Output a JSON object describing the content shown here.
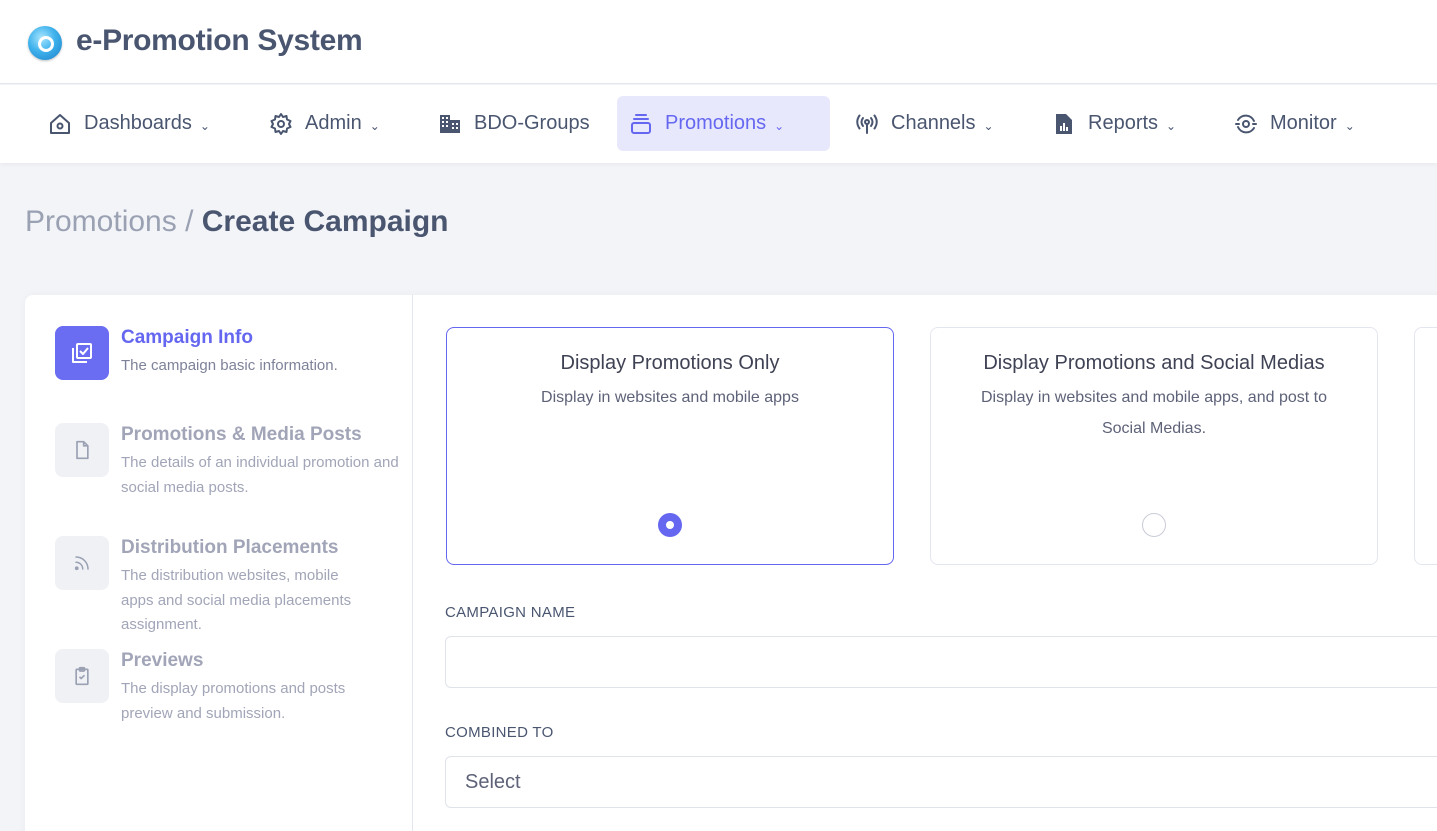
{
  "app": {
    "title": "e-Promotion System"
  },
  "nav": {
    "items": [
      {
        "label": "Dashboards",
        "icon": "home-icon",
        "dropdown": true
      },
      {
        "label": "Admin",
        "icon": "gear-icon",
        "dropdown": true
      },
      {
        "label": "BDO-Groups",
        "icon": "buildings-icon",
        "dropdown": false
      },
      {
        "label": "Promotions",
        "icon": "stack-icon",
        "dropdown": true,
        "active": true
      },
      {
        "label": "Channels",
        "icon": "broadcast-icon",
        "dropdown": true
      },
      {
        "label": "Reports",
        "icon": "report-file-icon",
        "dropdown": true
      },
      {
        "label": "Monitor",
        "icon": "monitor-eye-icon",
        "dropdown": true
      }
    ]
  },
  "breadcrumb": {
    "parent": "Promotions /",
    "current": "Create Campaign"
  },
  "steps": [
    {
      "title": "Campaign Info",
      "desc": "The campaign basic information.",
      "icon": "checklist-icon",
      "active": true
    },
    {
      "title": "Promotions & Media Posts",
      "desc": "The details of an individual promotion and social media posts.",
      "icon": "document-icon",
      "active": false
    },
    {
      "title": "Distribution Placements",
      "desc": "The distribution websites, mobile apps and social media placements assignment.",
      "icon": "rss-icon",
      "active": false
    },
    {
      "title": "Previews",
      "desc": "The display promotions and posts preview and submission.",
      "icon": "clipboard-check-icon",
      "active": false
    }
  ],
  "campaign_types": [
    {
      "title": "Display Promotions Only",
      "desc": "Display in websites and mobile apps",
      "selected": true
    },
    {
      "title": "Display Promotions and Social Medias",
      "desc": "Display in websites and mobile apps, and post to Social Medias.",
      "selected": false
    }
  ],
  "form": {
    "campaign_name": {
      "label": "CAMPAIGN NAME",
      "value": ""
    },
    "combined_to": {
      "label": "COMBINED TO",
      "value": "Select"
    }
  },
  "colors": {
    "accent": "#6567f0",
    "accent_bg": "#e8e8fd",
    "text": "#4a5670",
    "muted": "#a1a5b7"
  }
}
